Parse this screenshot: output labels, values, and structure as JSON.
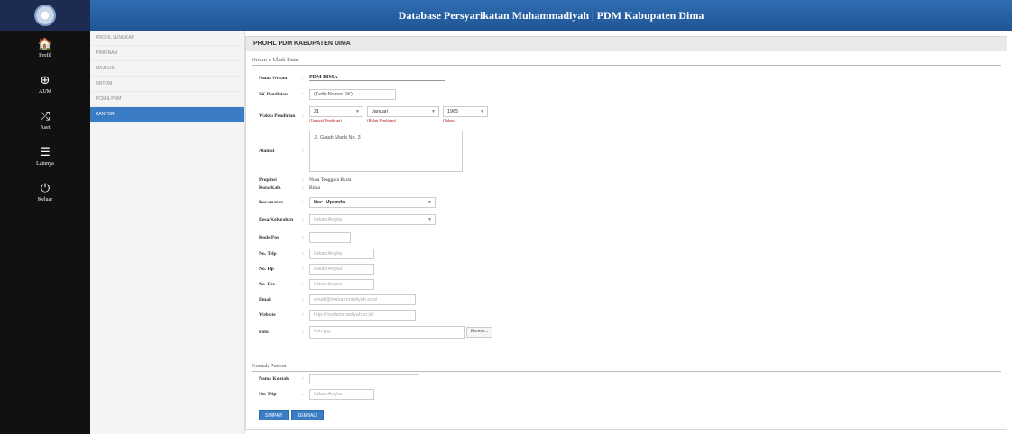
{
  "header": {
    "title": "Database Persyarikatan Muhammadiyah | PDM Kabupaten Dima"
  },
  "icon_nav": [
    {
      "icon": "home-icon",
      "glyph": "🏠",
      "label": "Profil"
    },
    {
      "icon": "globe-icon",
      "glyph": "⊕",
      "label": "AUM"
    },
    {
      "icon": "shuffle-icon",
      "glyph": "⤮",
      "label": "Aset"
    },
    {
      "icon": "list-icon",
      "glyph": "☰",
      "label": "Lainnya"
    },
    {
      "icon": "power-icon",
      "glyph": "⏻",
      "label": "Keluar"
    }
  ],
  "menu": [
    {
      "label": "PROFIL LENGKAP",
      "active": false
    },
    {
      "label": "PIMPINAN",
      "active": false
    },
    {
      "label": "MAJELIS",
      "active": false
    },
    {
      "label": "ORTOM",
      "active": false
    },
    {
      "label": "PCM & PRM",
      "active": false
    },
    {
      "label": "KANTOR",
      "active": true
    }
  ],
  "panel": {
    "title": "PROFIL PDM KABUPATEN DIMA",
    "section1": "Ortom » Ubah Data",
    "section2": "Kontak Person"
  },
  "form": {
    "nama_ortom": {
      "label": "Nama Ortom",
      "value": "PDM BIMA"
    },
    "sk_pendirian": {
      "label": "SK Pendirian",
      "value": "(Ketik Nomor SK)"
    },
    "waktu_pendirian": {
      "label": "Waktu Pendirian",
      "day": "21",
      "month": "Januari",
      "year": "1965",
      "hint_day": "(Tanggal Pendirian)",
      "hint_month": "(Bulan Pendirian)",
      "hint_year": "(Tahun)"
    },
    "alamat": {
      "label": "Alamat",
      "value": "Jl. Gajah Mada No. 3"
    },
    "propinsi": {
      "label": "Propinsi",
      "value": "Nusa Tenggara Barat"
    },
    "kota_kab": {
      "label": "Kota/Kab.",
      "value": "Bima"
    },
    "kecamatan": {
      "label": "Kecamatan",
      "value": "Kec. Mpunda"
    },
    "desa": {
      "label": "Desa/Kelurahan",
      "placeholder": "Isikan Angka"
    },
    "kode_pos": {
      "label": "Kode Pos",
      "value": ""
    },
    "no_telp": {
      "label": "No. Telp",
      "placeholder": "Isikan Angka"
    },
    "no_hp": {
      "label": "No. Hp",
      "placeholder": "Isikan Angka"
    },
    "no_fax": {
      "label": "No. Fax",
      "placeholder": "Isikan Angka"
    },
    "email": {
      "label": "Email",
      "placeholder": "email@muhammadiyah.or.id"
    },
    "website": {
      "label": "Website",
      "placeholder": "http://muhammadiyah.or.id"
    },
    "foto": {
      "label": "Foto",
      "placeholder": "foto.jpg",
      "button": "Browse..."
    },
    "kontak_nama": {
      "label": "Nama Kontak",
      "value": ""
    },
    "kontak_telp": {
      "label": "No. Telp",
      "placeholder": "Isikan Angka"
    }
  },
  "buttons": {
    "save": "SIMPAN",
    "reset": "KEMBALI"
  },
  "colors": {
    "header": "#2f6db0",
    "sidebar": "#111111",
    "accent": "#3b7dc4"
  }
}
